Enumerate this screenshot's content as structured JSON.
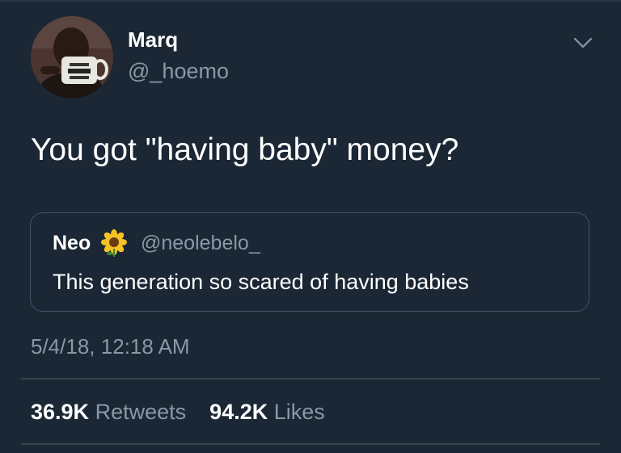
{
  "tweet": {
    "author": {
      "display_name": "Marq",
      "handle": "@_hoemo",
      "avatar_icon": "profile-photo"
    },
    "menu_icon": "chevron-down-icon",
    "text": "You got \"having baby\" money?",
    "quoted_tweet": {
      "author_name": "Neo",
      "author_emoji": "sunflower",
      "author_handle": "@neolebelo_",
      "text": "This generation so scared of having babies"
    },
    "timestamp": "5/4/18, 12:18 AM",
    "stats": {
      "retweets_count": "36.9K",
      "retweets_label": "Retweets",
      "likes_count": "94.2K",
      "likes_label": "Likes"
    }
  },
  "colors": {
    "background": "#1b2734",
    "secondary_text": "#8899a6",
    "primary_text": "#ffffff",
    "divider": "#38444d"
  }
}
